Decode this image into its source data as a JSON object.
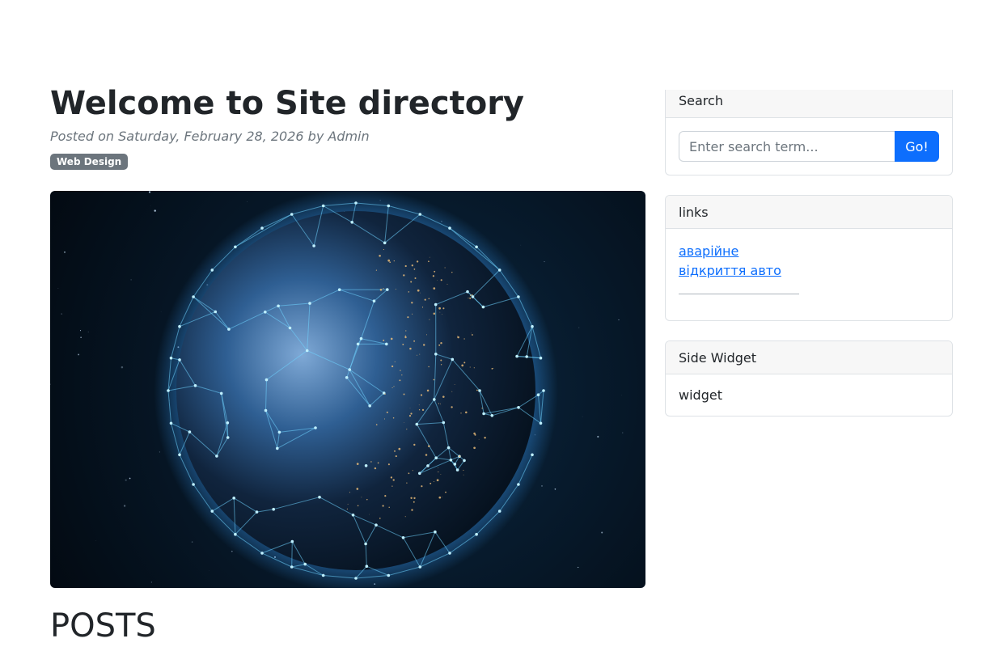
{
  "post": {
    "title": "Welcome to Site directory",
    "meta": "Posted on Saturday, February 28, 2026 by Admin",
    "badge": "Web Design",
    "posts_heading": "POSTS"
  },
  "sidebar": {
    "search": {
      "header": "Search",
      "placeholder": "Enter search term...",
      "button": "Go!"
    },
    "links": {
      "header": "links",
      "items": [
        "аварійне",
        "відкриття авто"
      ]
    },
    "widget": {
      "header": "Side Widget",
      "body": "widget"
    }
  },
  "colors": {
    "primary": "#0d6efd",
    "badge": "#6c757d"
  }
}
